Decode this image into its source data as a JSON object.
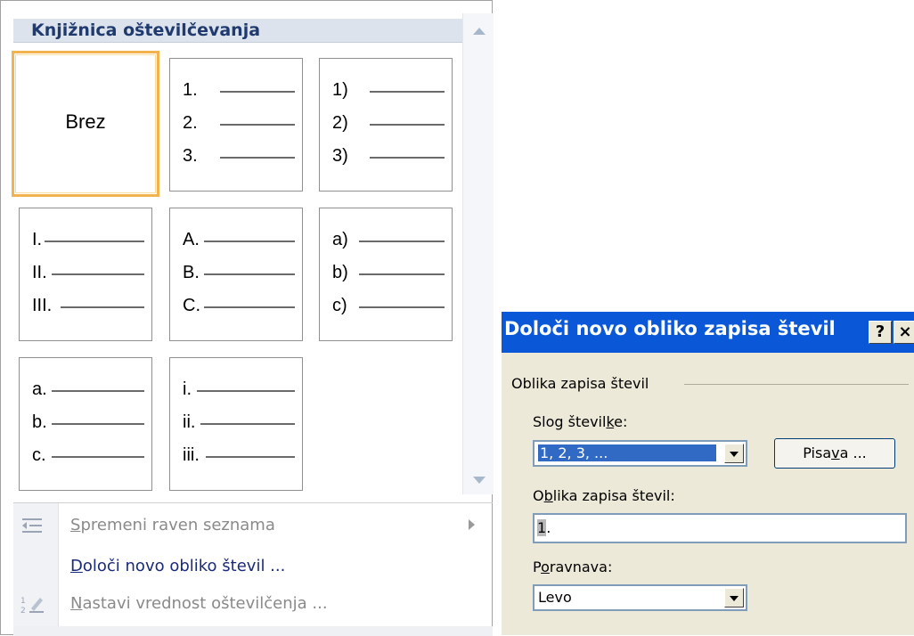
{
  "library": {
    "title": "Knjižnica oštevilčevanja",
    "tiles": [
      {
        "label": "Brez"
      },
      {
        "rows": [
          "1.",
          "2.",
          "3."
        ]
      },
      {
        "rows": [
          "1)",
          "2)",
          "3)"
        ]
      },
      {
        "rows": [
          "I.",
          "II.",
          "III."
        ]
      },
      {
        "rows": [
          "A.",
          "B.",
          "C."
        ]
      },
      {
        "rows": [
          "a)",
          "b)",
          "c)"
        ]
      },
      {
        "rows": [
          "a.",
          "b.",
          "c."
        ]
      },
      {
        "rows": [
          "i.",
          "ii.",
          "iii."
        ]
      }
    ],
    "menu": {
      "change_level": {
        "pre": "",
        "key": "S",
        "post": "premeni raven seznama"
      },
      "define_new": {
        "pre": "",
        "key": "D",
        "post": "oloči novo obliko števil ..."
      },
      "set_value": {
        "pre": "",
        "key": "N",
        "post": "astavi vrednost oštevilčenja ..."
      }
    }
  },
  "dialog": {
    "title": "Določi novo obliko zapisa števil",
    "help": "?",
    "close": "×",
    "group_label": "Oblika zapisa števil",
    "style_label": {
      "pre": "Slog števil",
      "key": "k",
      "post": "e:"
    },
    "style_value": "1, 2, 3, ...",
    "font_button": {
      "pre": "Pisa",
      "key": "v",
      "post": "a ..."
    },
    "format_label": {
      "pre": "O",
      "key": "b",
      "post": "lika zapisa števil:"
    },
    "format_value_num": "1",
    "format_value_rest": ".",
    "align_label": {
      "pre": "P",
      "key": "o",
      "post": "ravnava:"
    },
    "align_value": "Levo"
  }
}
